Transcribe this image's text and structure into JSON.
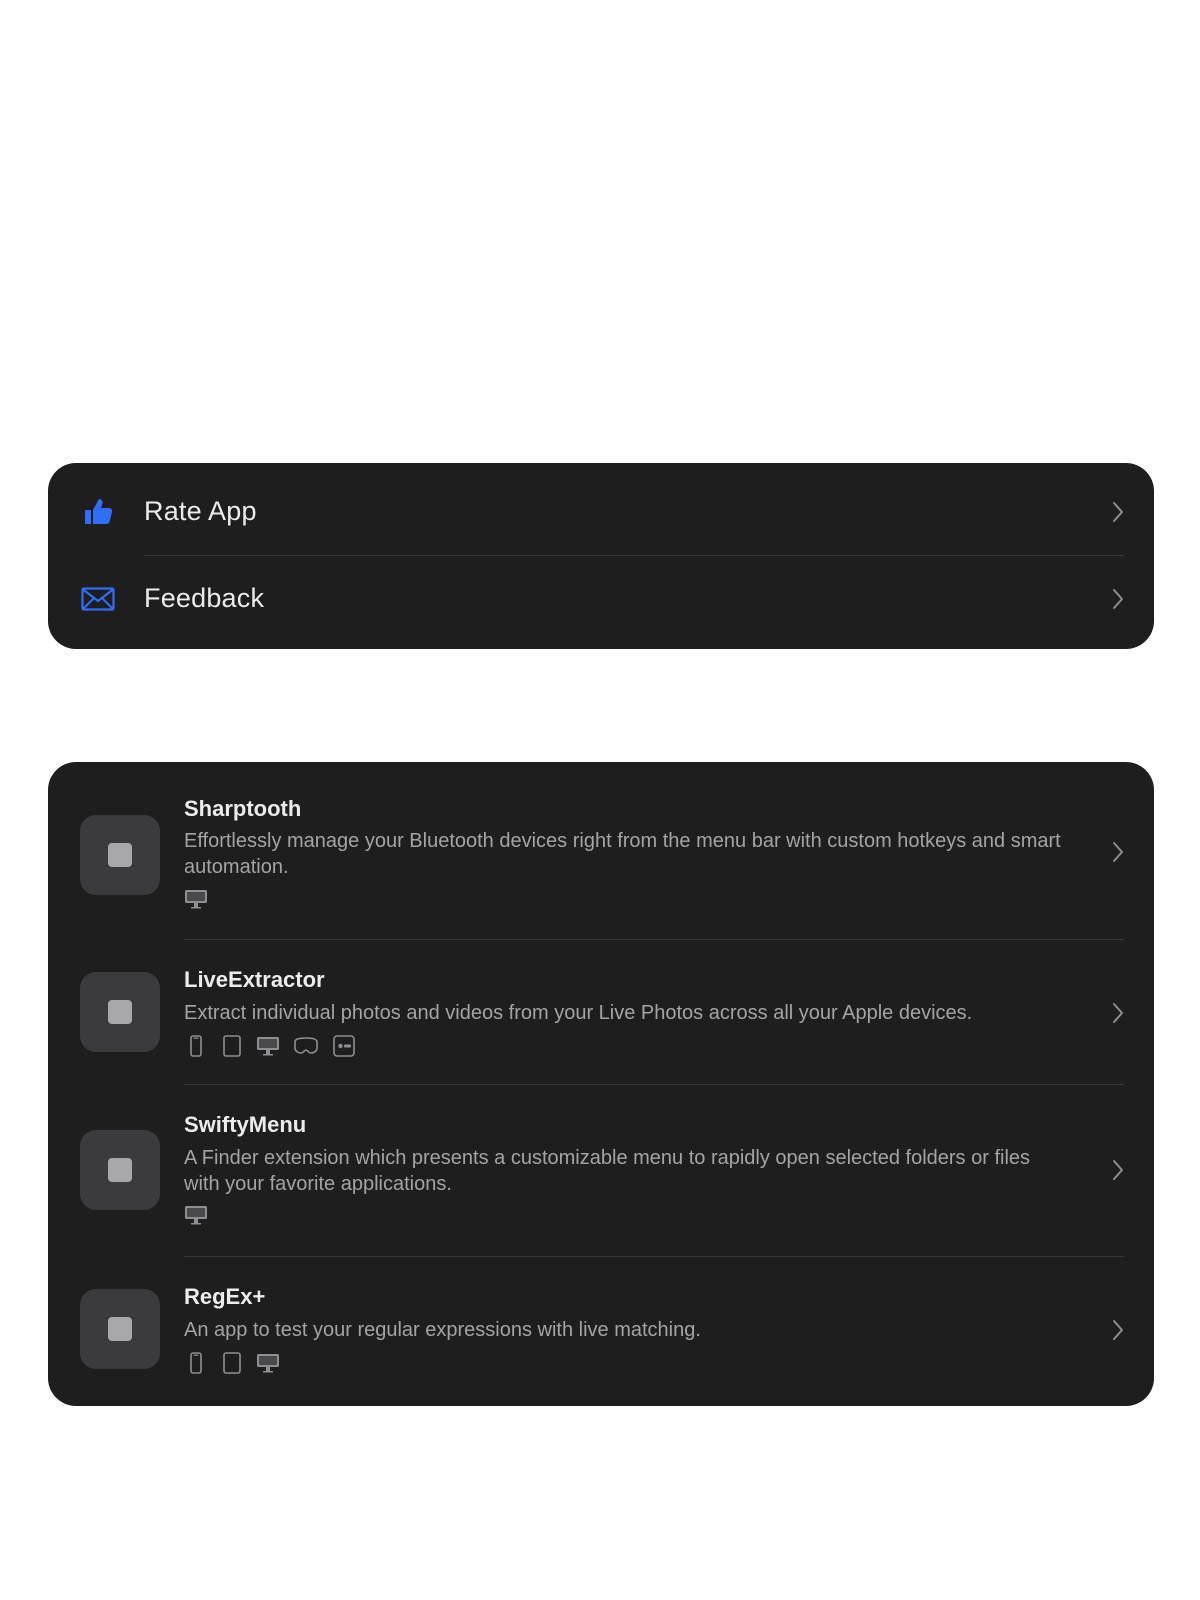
{
  "actions": {
    "items": [
      {
        "label": "Rate App",
        "icon": "thumbs-up-icon"
      },
      {
        "label": "Feedback",
        "icon": "envelope-icon"
      }
    ],
    "accent": "#2f6ef5"
  },
  "apps": {
    "items": [
      {
        "name": "Sharptooth",
        "description": "Effortlessly manage your Bluetooth devices right from the menu bar with custom hotkeys and smart automation.",
        "platforms": [
          "mac"
        ]
      },
      {
        "name": "LiveExtractor",
        "description": "Extract individual photos and videos from your Live Photos across all your Apple devices.",
        "platforms": [
          "iphone",
          "ipad",
          "mac",
          "vision",
          "tv"
        ]
      },
      {
        "name": "SwiftyMenu",
        "description": "A Finder extension which presents a customizable menu to rapidly open selected folders or files with your favorite applications.",
        "platforms": [
          "mac"
        ]
      },
      {
        "name": "RegEx+",
        "description": "An app to test your regular expressions with live matching.",
        "platforms": [
          "iphone",
          "ipad",
          "mac"
        ]
      }
    ]
  },
  "colors": {
    "card_background": "#1e1e1f",
    "page_background": "#fefefe",
    "primary_text": "#ececec",
    "secondary_text": "#a4a4a6"
  }
}
